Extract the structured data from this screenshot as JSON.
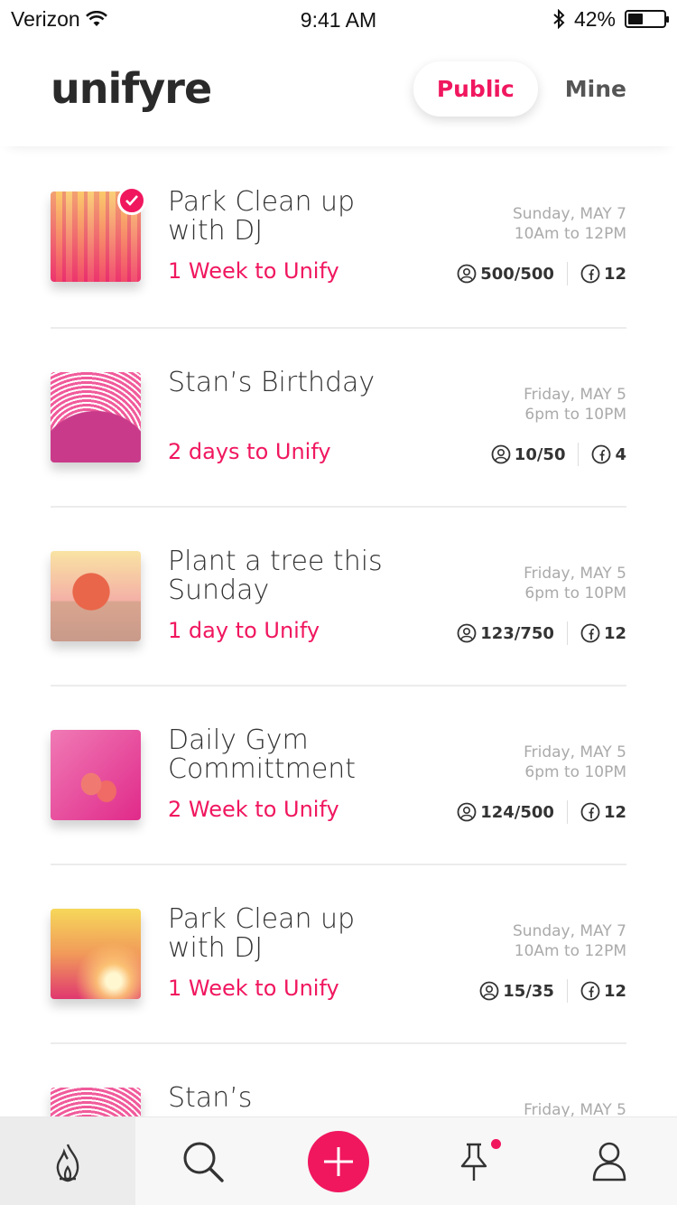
{
  "status_bar": {
    "carrier": "Verizon",
    "time": "9:41 AM",
    "battery": "42%",
    "battery_level": 0.42
  },
  "header": {
    "logo": "unifyre",
    "tab_public": "Public",
    "tab_mine": "Mine"
  },
  "events": [
    {
      "title": "Park Clean up with DJ",
      "countdown": "1 Week to Unify",
      "day": "Sunday, MAY 7",
      "hours": "10Am to 12PM",
      "people": "500/500",
      "shares": "12",
      "checked": true,
      "thumb": "forest"
    },
    {
      "title": "Stan’s Birthday",
      "countdown": "2 days to Unify",
      "day": "Friday, MAY 5",
      "hours": "6pm to 10PM",
      "people": "10/50",
      "shares": "4",
      "checked": false,
      "thumb": "cake"
    },
    {
      "title": "Plant a tree this Sunday",
      "countdown": "1 day to Unify",
      "day": "Friday, MAY 5",
      "hours": "6pm to 10PM",
      "people": "123/750",
      "shares": "12",
      "checked": false,
      "thumb": "tree"
    },
    {
      "title": "Daily Gym Committment",
      "countdown": "2 Week to Unify",
      "day": "Friday, MAY 5",
      "hours": "6pm to 10PM",
      "people": "124/500",
      "shares": "12",
      "checked": false,
      "thumb": "gym"
    },
    {
      "title": "Park Clean up with DJ",
      "countdown": "1 Week to Unify",
      "day": "Sunday, MAY 7",
      "hours": "10Am to 12PM",
      "people": "15/35",
      "shares": "12",
      "checked": false,
      "thumb": "sun"
    },
    {
      "title": "Stan’s",
      "countdown": "",
      "day": "Friday, MAY 5",
      "hours": "",
      "people": "",
      "shares": "",
      "checked": false,
      "thumb": "cake"
    }
  ],
  "tabbar": {
    "icons": [
      "flame-icon",
      "search-icon",
      "add-icon",
      "pin-icon",
      "profile-icon"
    ],
    "accent": "#f0175f"
  }
}
